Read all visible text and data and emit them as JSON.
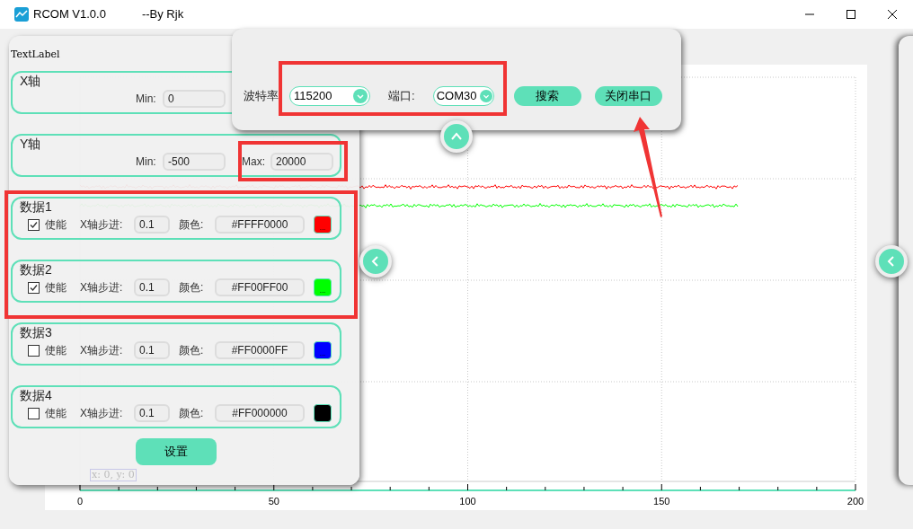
{
  "window": {
    "title": "RCOM V1.0.0",
    "subtitle": "--By Rjk"
  },
  "chart": {
    "x_labels": [
      "0",
      "50",
      "100",
      "150",
      "200"
    ],
    "cursor": "x: 0, y: 0"
  },
  "settings_panel": {
    "label": "TextLabel",
    "x_axis": {
      "title": "X轴",
      "min_label": "Min:",
      "min": "0"
    },
    "y_axis": {
      "title": "Y轴",
      "min_label": "Min:",
      "min": "-500",
      "max_label": "Max:",
      "max": "20000"
    },
    "channels": [
      {
        "title": "数据1",
        "enable": "使能",
        "checked": true,
        "step_label": "X轴步进:",
        "step": "0.1",
        "color_label": "颜色:",
        "hex": "#FFFF0000",
        "color": "#ff0000",
        "swatch": "..."
      },
      {
        "title": "数据2",
        "enable": "使能",
        "checked": true,
        "step_label": "X轴步进:",
        "step": "0.1",
        "color_label": "颜色:",
        "hex": "#FF00FF00",
        "color": "#00ff00",
        "swatch": "..."
      },
      {
        "title": "数据3",
        "enable": "使能",
        "checked": false,
        "step_label": "X轴步进:",
        "step": "0.1",
        "color_label": "颜色:",
        "hex": "#FF0000FF",
        "color": "#0000ff",
        "swatch": "..."
      },
      {
        "title": "数据4",
        "enable": "使能",
        "checked": false,
        "step_label": "X轴步进:",
        "step": "0.1",
        "color_label": "颜色:",
        "hex": "#FF000000",
        "color": "#000000"
      }
    ],
    "apply": "设置"
  },
  "serial_panel": {
    "baud_label": "波特率",
    "baud": "115200",
    "port_label": "端口:",
    "port": "COM30",
    "search": "搜索",
    "close": "关闭串口"
  }
}
